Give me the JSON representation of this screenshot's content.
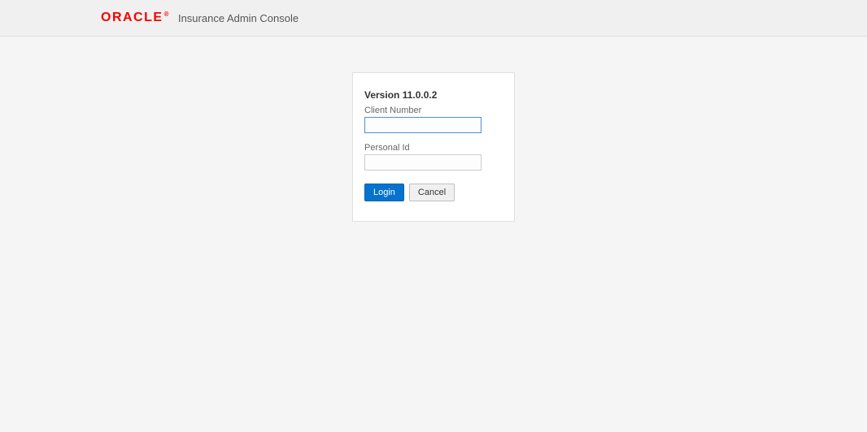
{
  "header": {
    "brand": "ORACLE",
    "app_title": "Insurance Admin Console"
  },
  "login": {
    "version_label": "Version 11.0.0.2",
    "client_number_label": "Client Number",
    "client_number_value": "",
    "personal_id_label": "Personal Id",
    "personal_id_value": "",
    "login_button": "Login",
    "cancel_button": "Cancel"
  }
}
